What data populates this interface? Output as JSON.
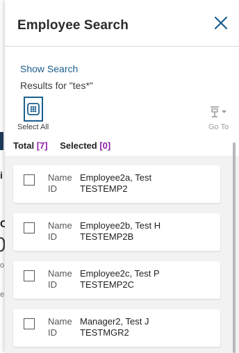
{
  "panel": {
    "title": "Employee Search",
    "close_icon": "close-x-icon"
  },
  "search": {
    "show_search_label": "Show Search",
    "results_for": "Results for \"tes*\""
  },
  "toolbar": {
    "select_all_label": "Select All",
    "select_all_icon": "grid-select-icon",
    "goto_label": "Go To",
    "goto_icon": "goto-filter-icon"
  },
  "counts": {
    "total_label": "Total",
    "total_value": "[7]",
    "selected_label": "Selected",
    "selected_value": "[0]"
  },
  "labels": {
    "name": "Name",
    "id": "ID"
  },
  "employees": [
    {
      "name": "Employee2a, Test",
      "id": "TESTEMP2"
    },
    {
      "name": "Employee2b, Test H",
      "id": "TESTEMP2B"
    },
    {
      "name": "Employee2c, Test P",
      "id": "TESTEMP2C"
    },
    {
      "name": "Manager2, Test J",
      "id": "TESTMGR2"
    }
  ],
  "background_fragments": [
    "i",
    "C",
    "0",
    "o",
    "e"
  ],
  "colors": {
    "accent": "#1a5e8c",
    "count_highlight": "#8e1ea8"
  }
}
